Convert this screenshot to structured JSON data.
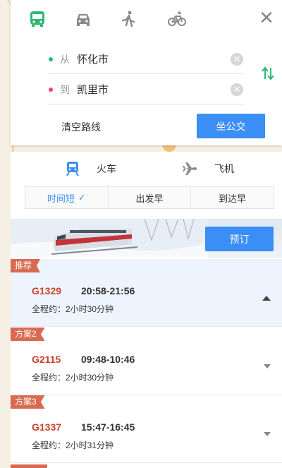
{
  "modes": [
    {
      "name": "bus",
      "active": true
    },
    {
      "name": "car",
      "active": false
    },
    {
      "name": "walk",
      "active": false
    },
    {
      "name": "bike",
      "active": false
    }
  ],
  "route": {
    "from_label": "从",
    "from_value": "怀化市",
    "to_label": "到",
    "to_value": "凯里市",
    "clear_route": "清空路线",
    "search_button": "坐公交"
  },
  "transport_tabs": {
    "train": "火车",
    "plane": "飞机"
  },
  "sort": {
    "options": [
      "时间短",
      "出发早",
      "到达早"
    ],
    "active_check": "✓"
  },
  "banner": {
    "book_button": "预订"
  },
  "trains": [
    {
      "tag": "推荐",
      "number": "G1329",
      "time": "20:58-21:56",
      "duration": "全程约：2小时30分钟"
    },
    {
      "tag": "方案2",
      "number": "G2115",
      "time": "09:48-10:46",
      "duration": "全程约：2小时30分钟"
    },
    {
      "tag": "方案3",
      "number": "G1337",
      "time": "15:47-16:45",
      "duration": "全程约：2小时31分钟"
    }
  ],
  "colors": {
    "accent": "#3a8ef6",
    "mode_active": "#2eb872",
    "from_dot": "#2eb872",
    "to_dot": "#e84a5f",
    "train_number": "#c9432d",
    "flag": "#d96a52"
  }
}
